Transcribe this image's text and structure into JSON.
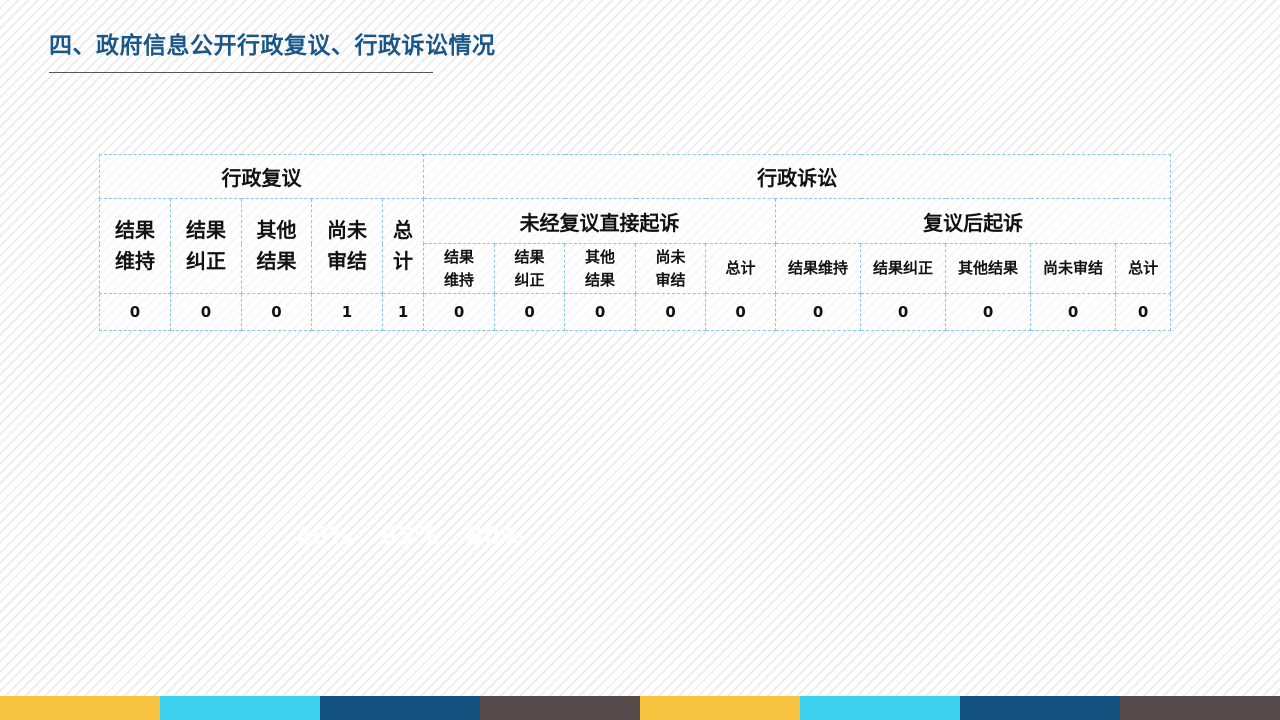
{
  "title": "四、政府信息公开行政复议、行政诉讼情况",
  "table": {
    "review_group": "行政复议",
    "litigation_group": "行政诉讼",
    "direct_group": "未经复议直接起诉",
    "after_review_group": "复议后起诉",
    "review_cols": [
      "结果维持",
      "结果纠正",
      "其他结果",
      "尚未审结",
      "总计"
    ],
    "direct_cols": [
      "结果维持",
      "结果纠正",
      "其他结果",
      "尚未审结",
      "总计"
    ],
    "after_cols": [
      "结果维持",
      "结果纠正",
      "其他结果",
      "尚未审结",
      "总计"
    ],
    "values": [
      "0",
      "0",
      "0",
      "1",
      "1",
      "0",
      "0",
      "0",
      "0",
      "0",
      "0",
      "0",
      "0",
      "0",
      "0"
    ]
  },
  "ghost_text": "40%  65%  80%",
  "footer_colors": [
    "#f7c23d",
    "#3ad0ee",
    "#14527f",
    "#564a4b",
    "#f7c23d",
    "#3ad0ee",
    "#14527f",
    "#564a4b"
  ]
}
